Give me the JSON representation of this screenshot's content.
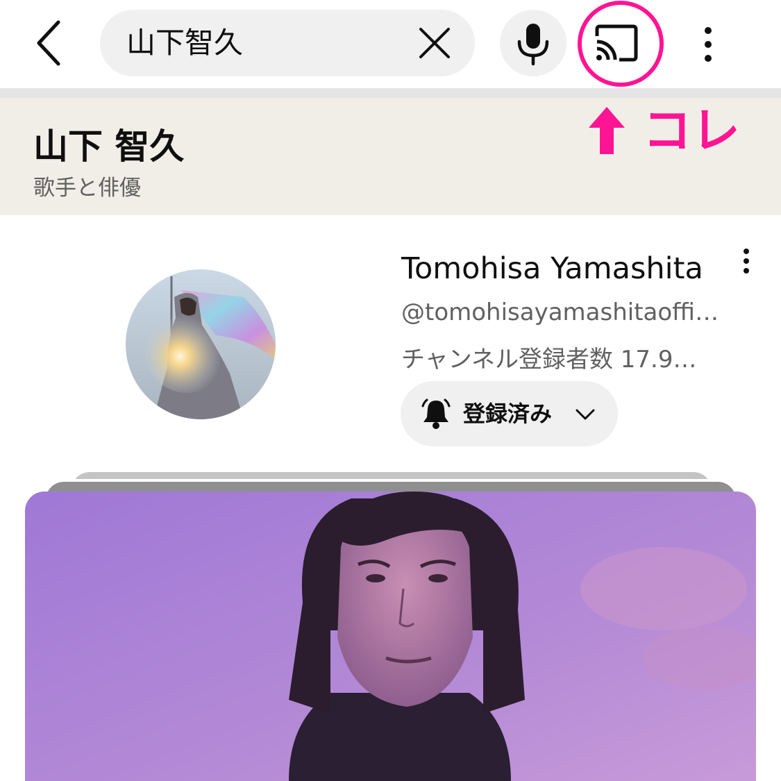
{
  "search": {
    "query": "山下智久"
  },
  "knowledge_panel": {
    "name": "山下 智久",
    "description": "歌手と俳優"
  },
  "annotation": {
    "text": "コレ",
    "color": "#ff1493"
  },
  "channel": {
    "name": "Tomohisa Yamashita",
    "handle": "@tomohisayamashitaofficial",
    "subscribers": "チャンネル登録者数 17.9…",
    "subscribe_label": "登録済み"
  },
  "colors": {
    "accent": "#ff1493",
    "panel_bg": "#f1eee8",
    "chip_bg": "#f0f0f0"
  }
}
